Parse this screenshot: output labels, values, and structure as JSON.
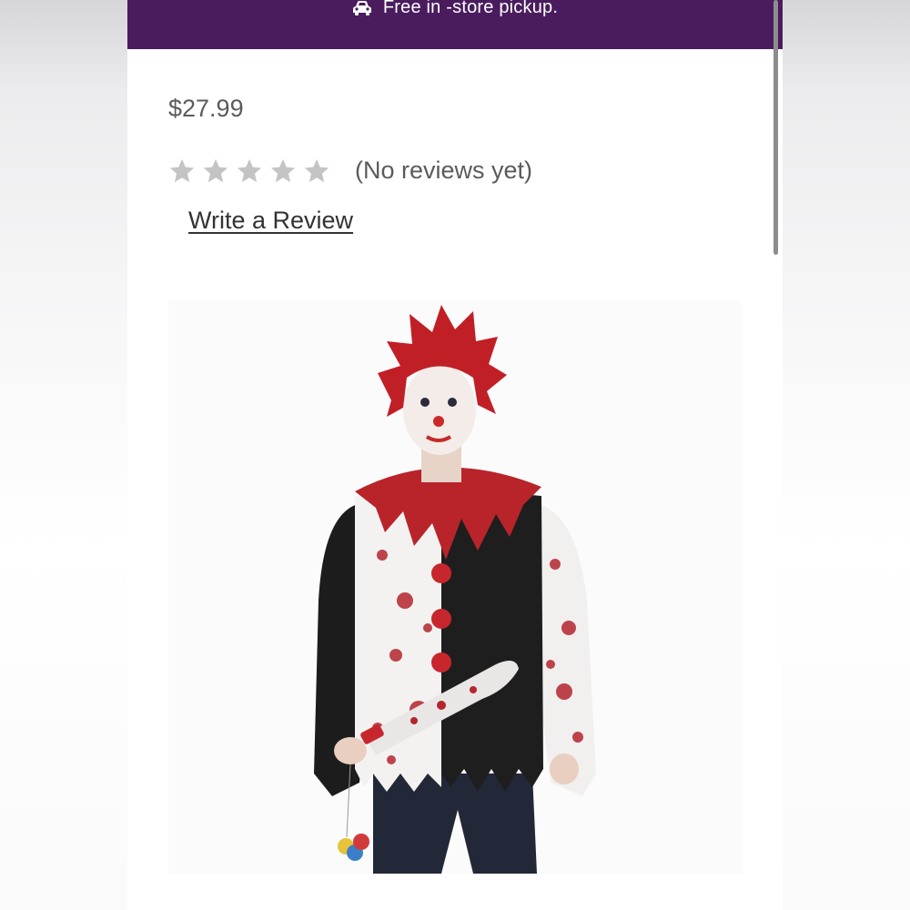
{
  "promo": {
    "icon": "car-icon",
    "text": "Free in -store pickup."
  },
  "product": {
    "price": "$27.99",
    "rating": {
      "stars_filled": 0,
      "stars_total": 5,
      "reviews_text": "(No reviews yet)"
    },
    "write_review_label": "Write a Review",
    "image": {
      "subject": "man in bloody clown costume shirt with red spiky wig and toy machete"
    }
  },
  "colors": {
    "promo_bar": "#4a1c5e",
    "star_empty": "#c4c4c4",
    "price_text": "#5b5b5b"
  }
}
